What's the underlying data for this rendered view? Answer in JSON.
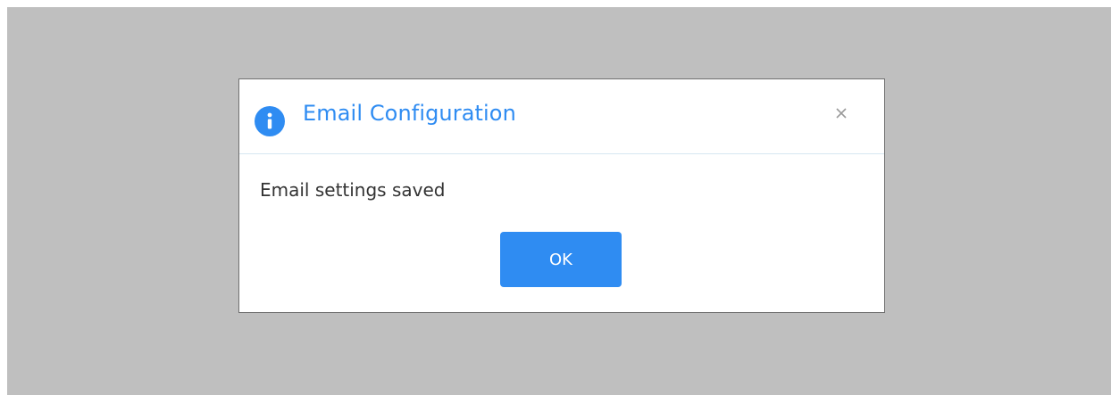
{
  "dialog": {
    "title": "Email Configuration",
    "message": "Email settings saved",
    "ok_label": "OK",
    "icon": "info-icon",
    "close_icon": "close-icon"
  },
  "colors": {
    "accent": "#2f8cf2",
    "backdrop": "#bfbfbf",
    "text": "#333333"
  }
}
